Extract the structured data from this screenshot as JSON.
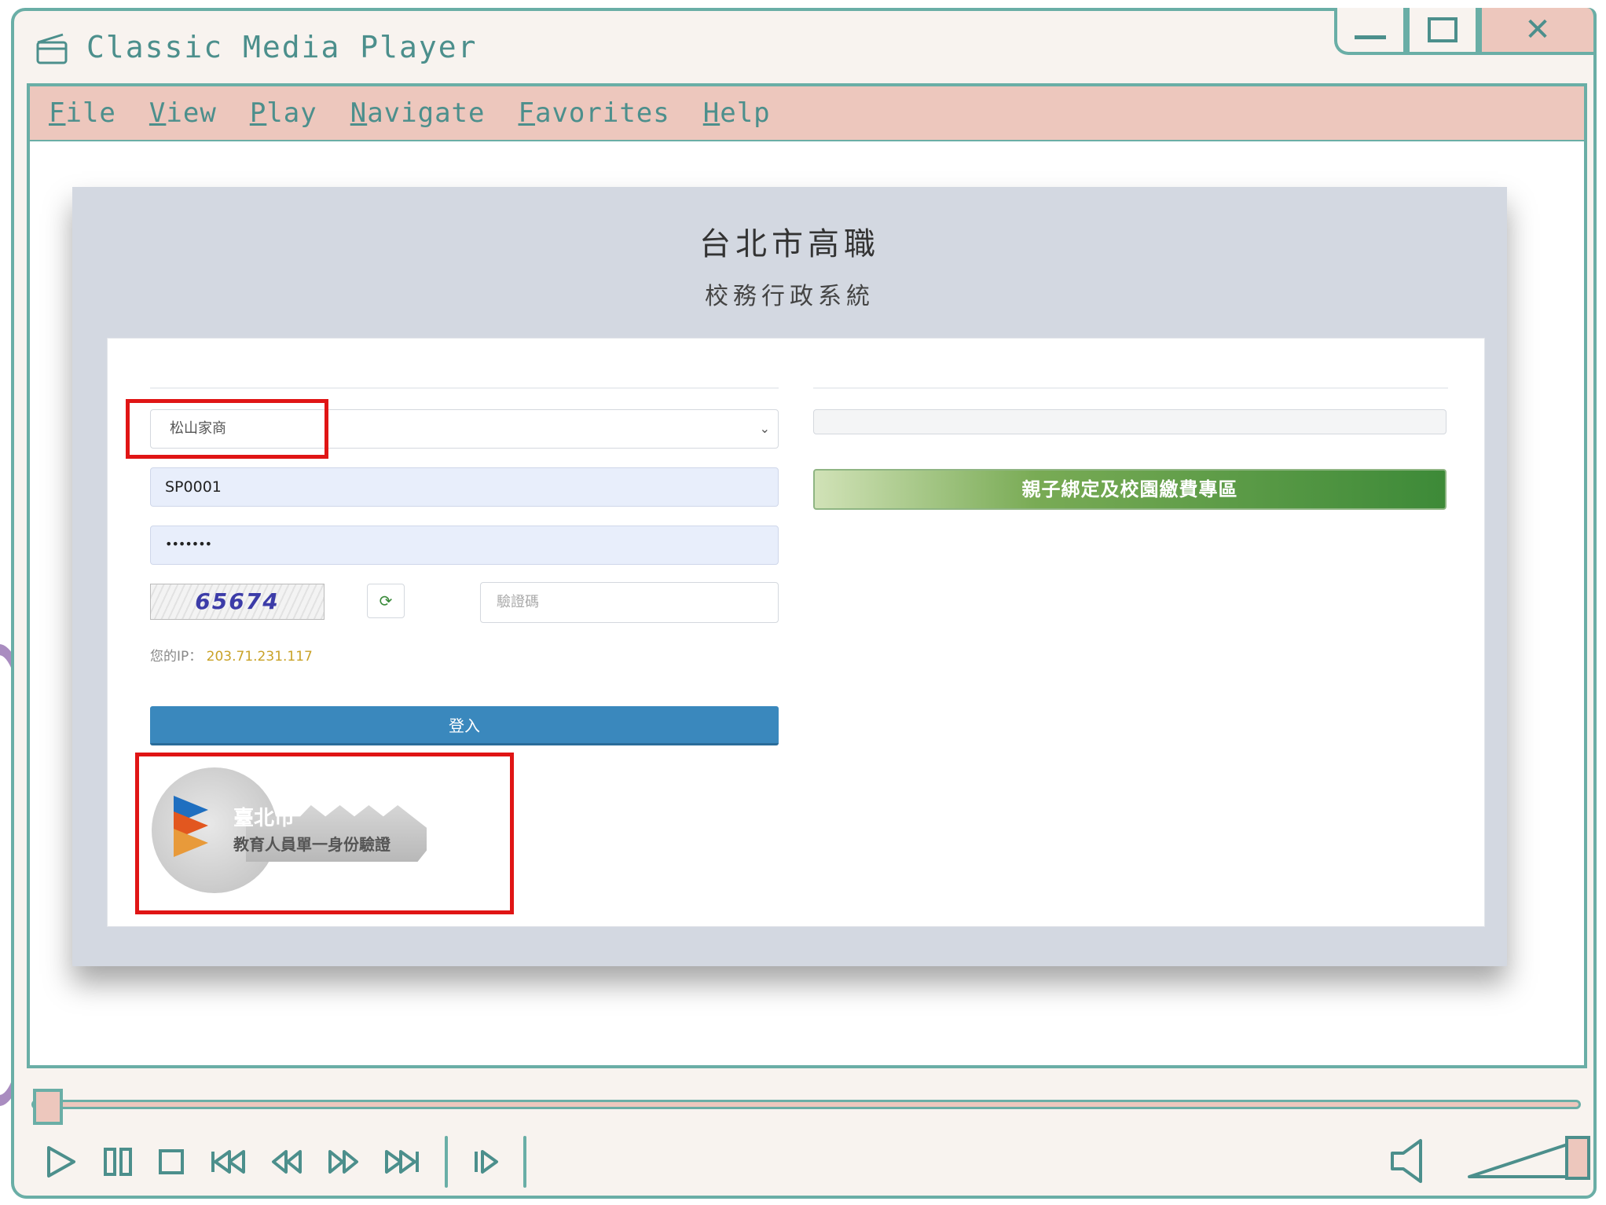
{
  "app": {
    "title": "Classic Media Player"
  },
  "menu": {
    "items": [
      "File",
      "View",
      "Play",
      "Navigate",
      "Favorites",
      "Help"
    ]
  },
  "webpage": {
    "school_name": "台北市高職",
    "system_name": "校務行政系統",
    "school_select_value": "松山家商",
    "username_value": "SP0001",
    "password_value": "•••••••",
    "captcha_code": "65674",
    "captcha_placeholder": "驗證碼",
    "ip_label": "您的IP：",
    "ip_value": "203.71.231.117",
    "login_label": "登入",
    "parent_binding_label": "親子綁定及校園繳費專區",
    "sso_line1": "臺北市",
    "sso_line2": "教育人員單一身份驗證"
  },
  "player": {
    "seek_progress": 0.0,
    "volume_level": 1.0
  },
  "colors": {
    "frame_teal": "#6aaea6",
    "accent_pink": "#edc7bd",
    "highlight_red": "#e01515",
    "login_blue": "#3a88bd",
    "green_button": "#3d8a38"
  },
  "icons": [
    "window-icon",
    "minimize-icon",
    "maximize-icon",
    "close-icon",
    "play-icon",
    "pause-icon",
    "stop-icon",
    "skip-back-icon",
    "rewind-icon",
    "fast-forward-icon",
    "skip-forward-icon",
    "frame-step-icon",
    "volume-icon",
    "refresh-icon",
    "chevron-down-icon"
  ]
}
